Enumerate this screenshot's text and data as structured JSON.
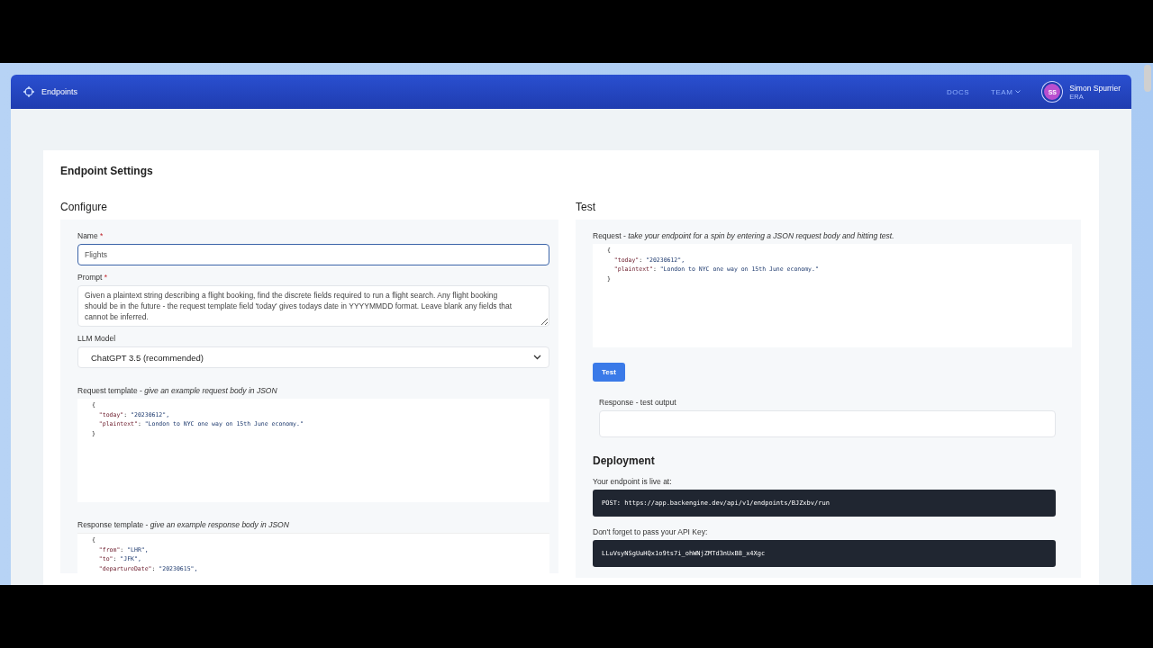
{
  "navbar": {
    "brand": "Endpoints",
    "links": [
      {
        "label": "DOCS",
        "dropdown": false
      },
      {
        "label": "TEAM",
        "dropdown": true
      }
    ],
    "user": {
      "initials": "SS",
      "name": "Simon Spurrier",
      "org": "ERA"
    }
  },
  "page": {
    "title": "Endpoint Settings"
  },
  "configure": {
    "heading": "Configure",
    "name": {
      "label": "Name",
      "required_mark": "*",
      "value": "Flights"
    },
    "prompt": {
      "label": "Prompt",
      "required_mark": "*",
      "value": "Given a plaintext string describing a flight booking, find the discrete fields required to run a flight search. Any flight booking should be in the future - the request template field 'today' gives todays date in YYYYMMDD format. Leave blank any fields that cannot be inferred."
    },
    "model": {
      "label": "LLM Model",
      "value": "ChatGPT 3.5 (recommended)"
    },
    "request_template": {
      "label": "Request template -",
      "hint": "give an example request body in JSON",
      "lines": [
        "{",
        "  \"today\": \"20230612\",",
        "  \"plaintext\": \"London to NYC one way on 15th June economy.\"",
        "}"
      ]
    },
    "response_template": {
      "label": "Response template -",
      "hint": "give an example response body in JSON",
      "lines": [
        "{",
        "  \"from\": \"LHR\",",
        "  \"to\": \"JFK\",",
        "  \"departureDate\": \"20230615\","
      ]
    }
  },
  "test": {
    "heading": "Test",
    "request": {
      "label": "Request -",
      "hint": "take your endpoint for a spin by entering a JSON request body and hitting test.",
      "lines": [
        "{",
        "  \"today\": \"20230612\",",
        "  \"plaintext\": \"London to NYC one way on 15th June economy.\"",
        "}"
      ]
    },
    "button": "Test",
    "response": {
      "label": "Response - test output"
    }
  },
  "deployment": {
    "heading": "Deployment",
    "live_label": "Your endpoint is live at:",
    "url": "POST: https://app.backengine.dev/api/v1/endpoints/BJZxbv/run",
    "key_label": "Don't forget to pass your API Key:",
    "key": "LLuVsyNSgUuHQx1o9ts7i_ohWNjZMTd3nUxB8_x4Xgc"
  }
}
